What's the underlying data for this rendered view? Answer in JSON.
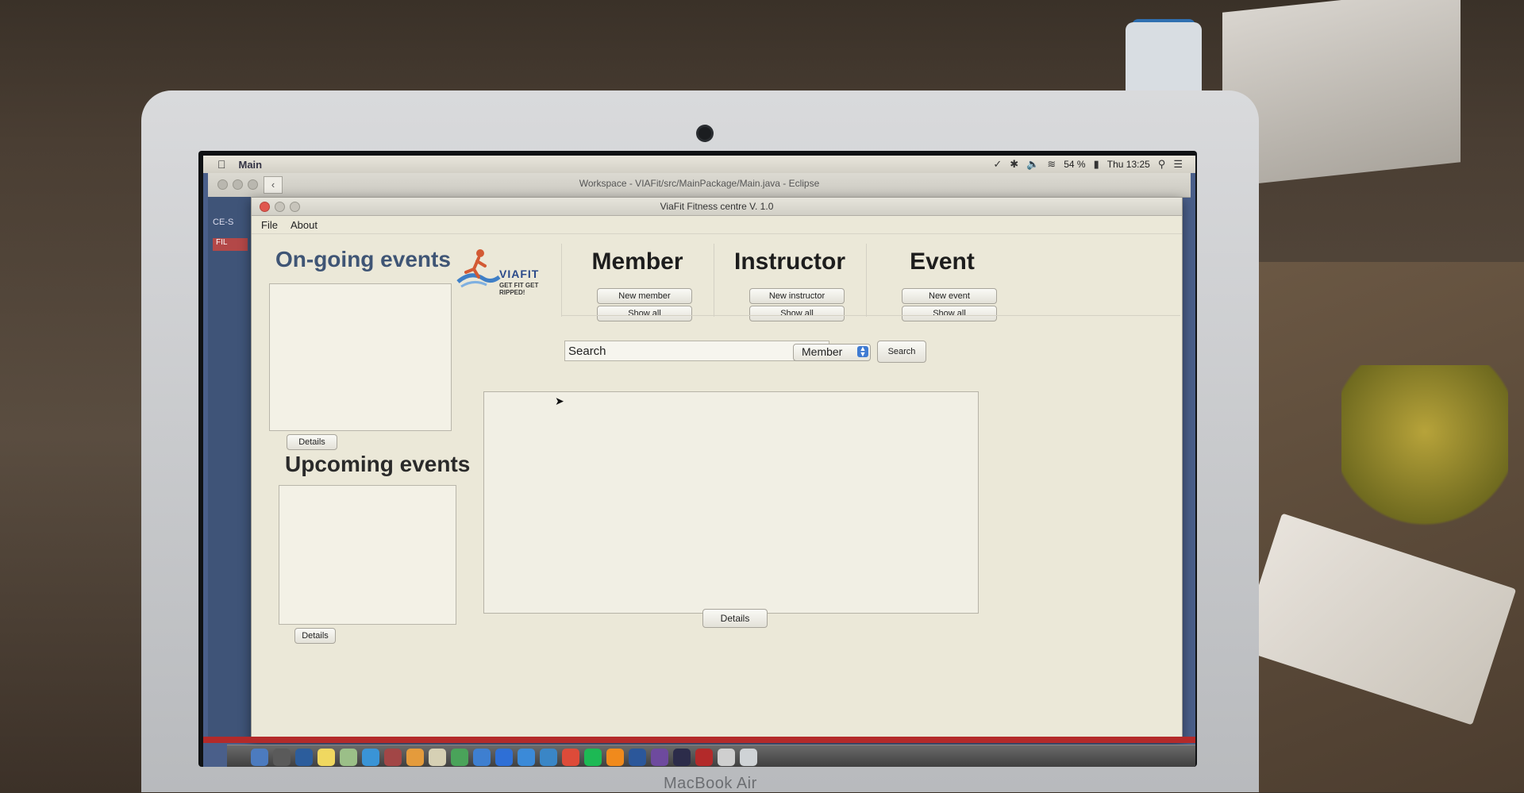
{
  "menubar": {
    "app_name": "Main",
    "battery": "54 %",
    "clock": "Thu 13:25"
  },
  "eclipse": {
    "title": "Workspace - VIAFit/src/MainPackage/Main.java - Eclipse"
  },
  "sidebar": {
    "label_1": "CE-S",
    "label_2": "FIL"
  },
  "window": {
    "title": "ViaFit Fitness centre V. 1.0",
    "menu": [
      "File",
      "About"
    ]
  },
  "logo": {
    "word": "VIAFIT",
    "tagline": "GET FIT GET RIPPED!"
  },
  "events": {
    "ongoing_title": "On-going events",
    "ongoing_details": "Details",
    "upcoming_title": "Upcoming events",
    "upcoming_details": "Details"
  },
  "columns": [
    {
      "title": "Member",
      "new_label": "New member",
      "show_label": "Show all"
    },
    {
      "title": "Instructor",
      "new_label": "New instructor",
      "show_label": "Show all"
    },
    {
      "title": "Event",
      "new_label": "New event",
      "show_label": "Show all"
    }
  ],
  "search": {
    "value": "Search",
    "type_selected": "Member",
    "button_label": "Search"
  },
  "results": {
    "details_label": "Details"
  },
  "laptop": {
    "brand": "MacBook Air"
  },
  "colors": {
    "window_bg": "#ebe8d8",
    "heading_blue": "#3f5575",
    "accent_blue": "#3f7bd2",
    "close_red": "#e0574e"
  }
}
